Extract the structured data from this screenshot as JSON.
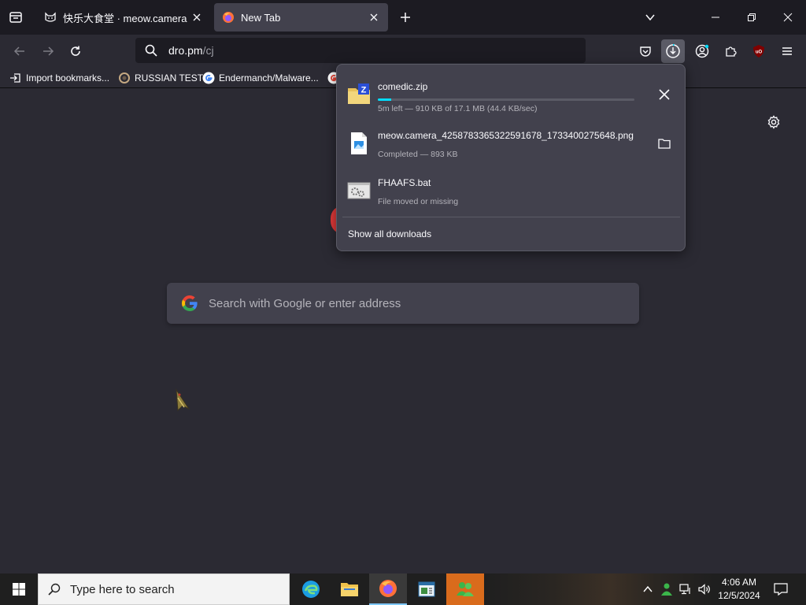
{
  "tabs": [
    {
      "label": "快乐大食堂 · meow.camera",
      "active": false,
      "favicon": "cat-icon"
    },
    {
      "label": "New Tab",
      "active": true,
      "favicon": "firefox-icon"
    }
  ],
  "navbar": {
    "url_host": "dro.pm",
    "url_path": "/cj"
  },
  "bookmarks": [
    {
      "label": "Import bookmarks...",
      "icon": "import-icon"
    },
    {
      "label": "RUSSIAN TEST",
      "icon": "site-icon"
    },
    {
      "label": "Endermanch/Malware...",
      "icon": "google-icon"
    }
  ],
  "search": {
    "placeholder": "Search with Google or enter address"
  },
  "downloads": {
    "items": [
      {
        "name": "comedic.zip",
        "status": "5m left — 910 KB of 17.1 MB (44.4 KB/sec)",
        "progress": 0.053,
        "action": "cancel"
      },
      {
        "name": "meow.camera_4258783365322591678_1733400275648.png",
        "status": "Completed — 893 KB",
        "action": "open-folder"
      },
      {
        "name": "FHAAFS.bat",
        "status": "File moved or missing",
        "action": "none"
      }
    ],
    "show_all_label": "Show all downloads"
  },
  "taskbar": {
    "search_placeholder": "Type here to search",
    "time": "4:06 AM",
    "date": "12/5/2024"
  },
  "colors": {
    "accent": "#00ddff",
    "panel": "#42414d",
    "page_bg": "#2b2a33"
  }
}
